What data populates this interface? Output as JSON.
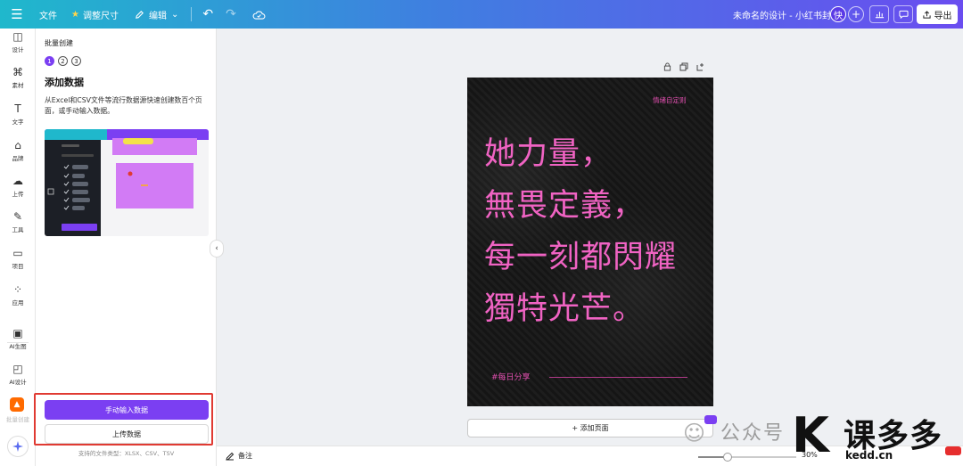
{
  "topbar": {
    "file": "文件",
    "resize": "调整尺寸",
    "edit": "编辑",
    "title": "未命名的设计 - 小红书封面",
    "avatar": "快",
    "export": "导出"
  },
  "rail": {
    "items": [
      {
        "label": "设计",
        "icon": "layout-icon"
      },
      {
        "label": "素材",
        "icon": "shapes-icon"
      },
      {
        "label": "文字",
        "icon": "text-icon"
      },
      {
        "label": "品牌",
        "icon": "brand-icon"
      },
      {
        "label": "上传",
        "icon": "cloud-upload-icon"
      },
      {
        "label": "工具",
        "icon": "pen-tool-icon"
      },
      {
        "label": "项目",
        "icon": "folder-icon"
      },
      {
        "label": "应用",
        "icon": "apps-icon"
      },
      {
        "label": "AI生图",
        "icon": "ai-image-icon"
      },
      {
        "label": "AI设计",
        "icon": "ai-design-icon"
      },
      {
        "label": "批量创建",
        "icon": "batch-icon"
      }
    ]
  },
  "panel": {
    "title": "批量创建",
    "steps": [
      "1",
      "2",
      "3"
    ],
    "heading": "添加数据",
    "description": "从Excel和CSV文件等流行数据源快速创建数百个页面，或手动输入数据。",
    "manual_button": "手动输入数据",
    "upload_button": "上传数据",
    "footer": "支持的文件类型：XLSX、CSV、TSV"
  },
  "poster": {
    "tag": "情绪自定则",
    "lines": [
      "她力量，",
      "無畏定義，",
      "每一刻都閃耀",
      "獨特光芒。"
    ],
    "hashtag": "#每日分享",
    "text_color": "#f063c3"
  },
  "canvas": {
    "add_page": "+ 添加页面"
  },
  "bottombar": {
    "notes": "备注",
    "zoom": "30%",
    "zoom_fraction": 0.3
  },
  "watermark": {
    "gzh": "公众号",
    "brand": "课多多",
    "site": "kedd.cn"
  },
  "colors": {
    "accent": "#7b3ff2",
    "highlight": "#e03a32"
  }
}
